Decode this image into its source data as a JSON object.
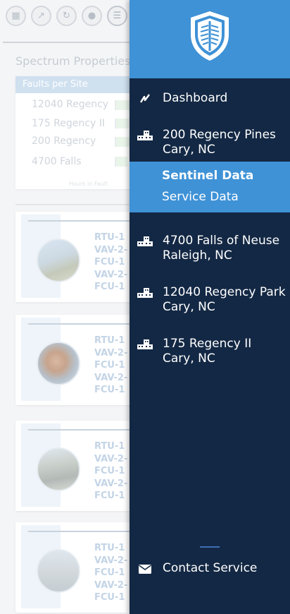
{
  "background": {
    "page_title": "Spectrum Properties",
    "faults_card": {
      "title": "Faults per Site",
      "sites": [
        "12040 Regency",
        "175 Regency II",
        "200 Regency",
        "4700 Falls"
      ],
      "axis_label": "Hours in Fault"
    },
    "site_cards": [
      {
        "units": [
          "RTU-1",
          "VAV-2-",
          "FCU-1",
          "VAV-2-",
          "FCU-1"
        ]
      },
      {
        "units": [
          "RTU-1",
          "VAV-2-",
          "FCU-1",
          "VAV-2-",
          "FCU-1"
        ]
      },
      {
        "units": [
          "RTU-1",
          "VAV-2-",
          "FCU-1",
          "VAV-2-",
          "FCU-1"
        ]
      },
      {
        "units": [
          "RTU-1",
          "VAV-2-",
          "FCU-1",
          "VAV-2-",
          "FCU-1"
        ]
      }
    ]
  },
  "drawer": {
    "nav": [
      {
        "icon": "pulse-icon",
        "line1": "Dashboard",
        "line2": ""
      },
      {
        "icon": "building-icon",
        "line1": "200 Regency Pines",
        "line2": "Cary, NC"
      }
    ],
    "active": {
      "title": "Sentinel Data",
      "subtitle": "Service Data"
    },
    "sites": [
      {
        "icon": "building-icon",
        "line1": "4700 Falls of Neuse",
        "line2": "Raleigh, NC"
      },
      {
        "icon": "building-icon",
        "line1": "12040 Regency Park",
        "line2": "Cary, NC"
      },
      {
        "icon": "building-icon",
        "line1": "175 Regency II",
        "line2": "Cary, NC"
      }
    ],
    "contact_label": "Contact Service"
  },
  "colors": {
    "drawer_bg": "#132844",
    "accent_blue": "#3f92d6"
  }
}
